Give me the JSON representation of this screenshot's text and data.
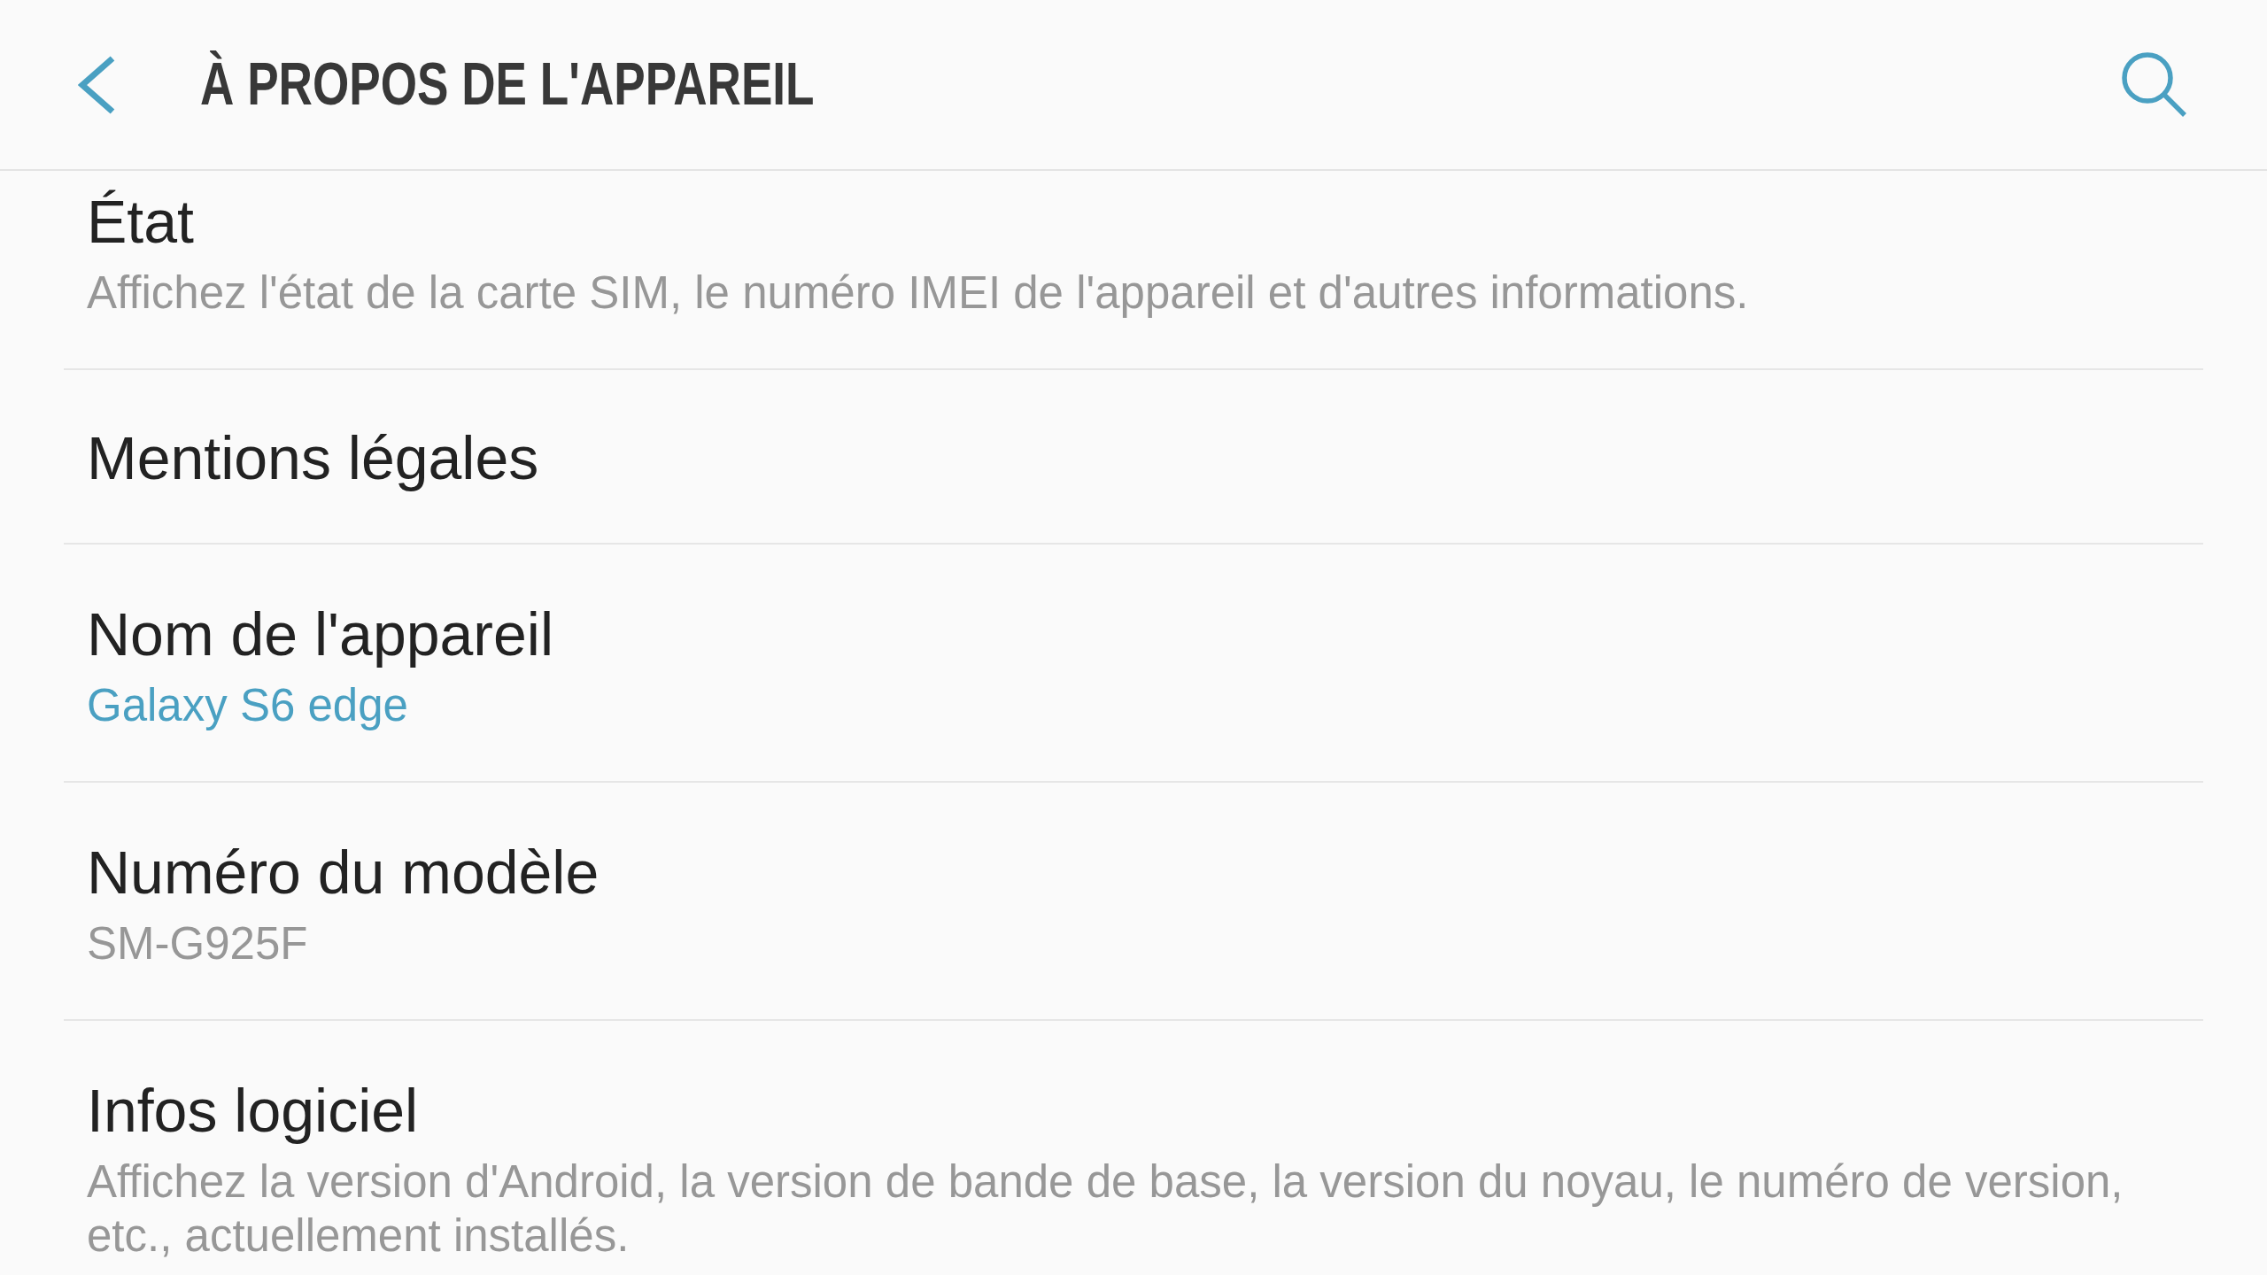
{
  "header": {
    "title": "À PROPOS DE L'APPAREIL"
  },
  "items": [
    {
      "title": "État",
      "summary": "Affichez l'état de la carte SIM, le numéro IMEI de l'appareil et d'autres informations.",
      "summary_accent": false
    },
    {
      "title": "Mentions légales"
    },
    {
      "title": "Nom de l'appareil",
      "summary": "Galaxy S6 edge",
      "summary_accent": true
    },
    {
      "title": "Numéro du modèle",
      "summary": "SM-G925F",
      "summary_accent": false
    },
    {
      "title": "Infos logiciel",
      "summary": "Affichez la version d'Android, la version de bande de base, la version du noyau, le numéro de version, etc., actuellement installés.",
      "summary_accent": false
    }
  ]
}
